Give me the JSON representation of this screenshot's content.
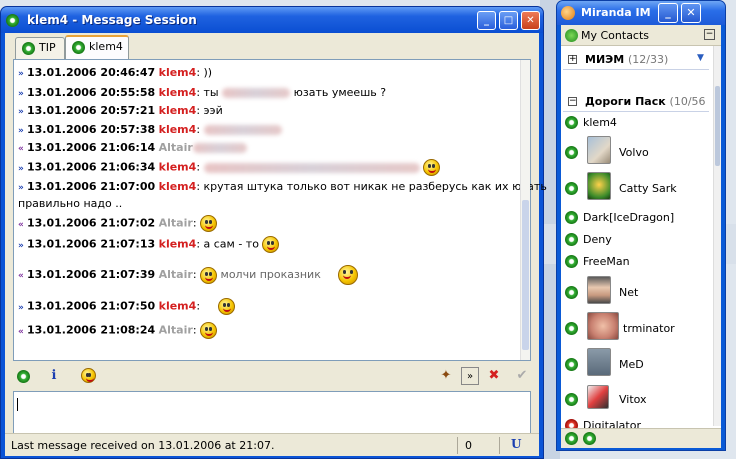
{
  "colors": {
    "titlebar": "#0a4ed2",
    "nick_self": "#d42020",
    "nick_other": "#a0a0a0",
    "tab_accent": "#e8a33a"
  },
  "message_window": {
    "title": "klem4 - Message Session",
    "tabs": [
      {
        "label": "TIP",
        "active": false
      },
      {
        "label": "klem4",
        "active": true
      }
    ],
    "messages": [
      {
        "direction": "out",
        "timestamp": "13.01.2006 20:46:47",
        "nick": "klem4",
        "text": "))"
      },
      {
        "direction": "out",
        "timestamp": "13.01.2006 20:55:58",
        "nick": "klem4",
        "text_before": "ты",
        "text_after": "юзать умеешь ?"
      },
      {
        "direction": "out",
        "timestamp": "13.01.2006 20:57:21",
        "nick": "klem4",
        "text": "ээй"
      },
      {
        "direction": "out",
        "timestamp": "13.01.2006 20:57:38",
        "nick": "klem4",
        "text": ""
      },
      {
        "direction": "in",
        "timestamp": "13.01.2006 21:06:14",
        "nick": "Altair",
        "text": ""
      },
      {
        "direction": "out",
        "timestamp": "13.01.2006 21:06:34",
        "nick": "klem4",
        "text": ""
      },
      {
        "direction": "out",
        "timestamp": "13.01.2006 21:07:00",
        "nick": "klem4",
        "text": "крутая штука только вот никак не разберусь как их юзать",
        "text_cont": "правильно надо .."
      },
      {
        "direction": "in",
        "timestamp": "13.01.2006 21:07:02",
        "nick": "Altair",
        "text": ""
      },
      {
        "direction": "out",
        "timestamp": "13.01.2006 21:07:13",
        "nick": "klem4",
        "text": "а сам - то"
      },
      {
        "direction": "in",
        "timestamp": "13.01.2006 21:07:39",
        "nick": "Altair",
        "text": "молчи проказник"
      },
      {
        "direction": "out",
        "timestamp": "13.01.2006 21:07:50",
        "nick": "klem4",
        "text": ""
      },
      {
        "direction": "in",
        "timestamp": "13.01.2006 21:08:24",
        "nick": "Altair",
        "text": ""
      }
    ],
    "status": {
      "text": "Last message received on 13.01.2006 at 21:07.",
      "count": "0",
      "unicode": "U"
    }
  },
  "miranda": {
    "title": "Miranda IM",
    "menu_label": "My Contacts",
    "groups": [
      {
        "name": "МИЭМ",
        "count": "(12/33)",
        "expanded": false
      },
      {
        "name": "Дороги Паск",
        "count": "(10/56",
        "expanded": true
      }
    ],
    "contacts": [
      "klem4",
      "Volvo",
      "Catty Sark",
      "Dark[IceDragon]",
      "Deny",
      "FreeMan",
      "Net",
      "trminator",
      "MeD",
      "Vitox",
      "Digitalator"
    ]
  }
}
